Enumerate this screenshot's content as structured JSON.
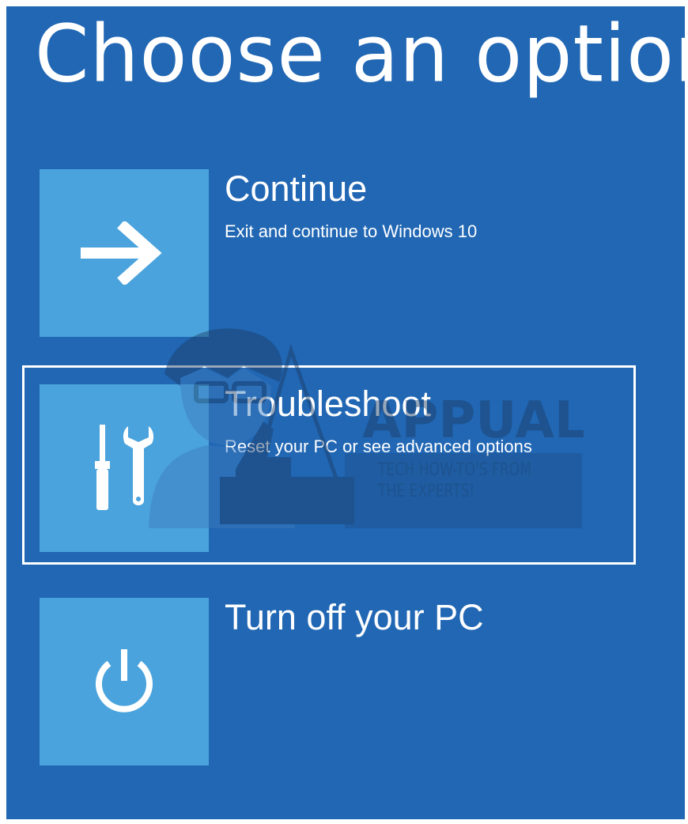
{
  "page": {
    "title": "Choose an option"
  },
  "options": [
    {
      "label": "Continue",
      "description": "Exit and continue to Windows 10",
      "icon": "arrow-right-icon"
    },
    {
      "label": "Troubleshoot",
      "description": "Reset your PC or see advanced options",
      "icon": "tools-icon",
      "focused": true
    },
    {
      "label": "Turn off your PC",
      "description": "",
      "icon": "power-icon"
    }
  ],
  "watermark": {
    "brand": "APPUALS",
    "tagline_line1": "TECH HOW-TO'S FROM",
    "tagline_line2": "THE EXPERTS!"
  },
  "colors": {
    "background": "#2167b4",
    "tile": "#4aa3dc",
    "text": "#ffffff",
    "focus_ring": "#ffffff"
  }
}
